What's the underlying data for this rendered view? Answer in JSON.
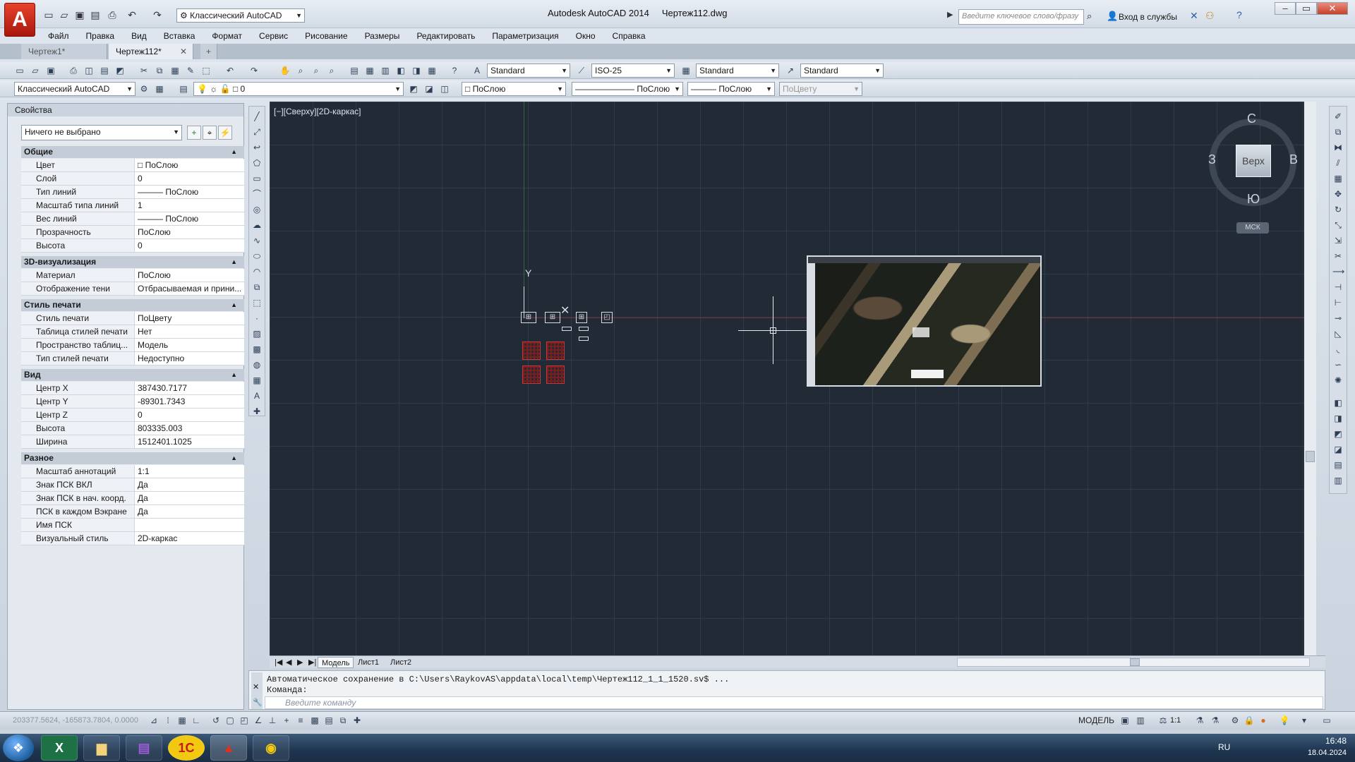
{
  "window": {
    "title": "Autodesk AutoCAD 2014",
    "filename": "Чертеж112.dwg",
    "search_placeholder": "Введите ключевое слово/фразу",
    "signin_label": "Вход в службы",
    "workspace": "Классический AutoCAD"
  },
  "menu": [
    "Файл",
    "Правка",
    "Вид",
    "Вставка",
    "Формат",
    "Сервис",
    "Рисование",
    "Размеры",
    "Редактировать",
    "Параметризация",
    "Окно",
    "Справка"
  ],
  "file_tabs": [
    "Чертеж1*",
    "Чертеж112*"
  ],
  "toolbar": {
    "text_style": "Standard",
    "dim_style": "ISO-25",
    "table_style": "Standard",
    "mleader_style": "Standard",
    "workspace": "Классический AutoCAD",
    "layer": "0",
    "color": "ПоСлою",
    "linetype": "ПоСлою",
    "lineweight": "ПоСлою",
    "plotstyle": "ПоЦвету"
  },
  "properties": {
    "title": "Свойства",
    "selection": "Ничего не выбрано",
    "sections": [
      {
        "name": "Общие",
        "rows": [
          [
            "Цвет",
            "ПоСлою"
          ],
          [
            "Слой",
            "0"
          ],
          [
            "Тип линий",
            "——— ПоСлою"
          ],
          [
            "Масштаб типа линий",
            "1"
          ],
          [
            "Вес линий",
            "——— ПоСлою"
          ],
          [
            "Прозрачность",
            "ПоСлою"
          ],
          [
            "Высота",
            "0"
          ]
        ]
      },
      {
        "name": "3D-визуализация",
        "rows": [
          [
            "Материал",
            "ПоСлою"
          ],
          [
            "Отображение тени",
            "Отбрасываемая и прини..."
          ]
        ]
      },
      {
        "name": "Стиль печати",
        "rows": [
          [
            "Стиль печати",
            "ПоЦвету"
          ],
          [
            "Таблица стилей печати",
            "Нет"
          ],
          [
            "Пространство таблиц...",
            "Модель"
          ],
          [
            "Тип стилей печати",
            "Недоступно"
          ]
        ]
      },
      {
        "name": "Вид",
        "rows": [
          [
            "Центр X",
            "387430.7177"
          ],
          [
            "Центр Y",
            "-89301.7343"
          ],
          [
            "Центр Z",
            "0"
          ],
          [
            "Высота",
            "803335.003"
          ],
          [
            "Ширина",
            "1512401.1025"
          ]
        ]
      },
      {
        "name": "Разное",
        "rows": [
          [
            "Масштаб аннотаций",
            "1:1"
          ],
          [
            "Знак ПСК ВКЛ",
            "Да"
          ],
          [
            "Знак ПСК в нач. коорд.",
            "Да"
          ],
          [
            "ПСК в каждом Вэкране",
            "Да"
          ],
          [
            "Имя ПСК",
            ""
          ],
          [
            "Визуальный стиль",
            "2D-каркас"
          ]
        ]
      }
    ]
  },
  "viewport": {
    "label": "[−][Сверху][2D-каркас]",
    "ucs_y": "Y",
    "viewcube": {
      "face": "Верх",
      "north": "С",
      "south": "Ю",
      "east": "В",
      "west": "З",
      "wcs": "МСК"
    }
  },
  "layout_tabs": [
    "Модель",
    "Лист1",
    "Лист2"
  ],
  "command": {
    "history": "Автоматическое сохранение в C:\\Users\\RaykovAS\\appdata\\local\\temp\\Чертеж112_1_1_1520.sv$ ...",
    "prompt": "Команда:",
    "placeholder": "Введите команду"
  },
  "status": {
    "coords": "203377.5624, -165873.7804, 0.0000",
    "model": "МОДЕЛЬ",
    "scale": "1:1"
  },
  "taskbar": {
    "apps": [
      "excel",
      "explorer",
      "winrar",
      "1c",
      "autocad",
      "chrome"
    ],
    "lang": "RU",
    "time": "16:48",
    "date": "18.04.2024"
  },
  "colors": {
    "canvas": "#212a35",
    "accent": "#c0392b"
  }
}
